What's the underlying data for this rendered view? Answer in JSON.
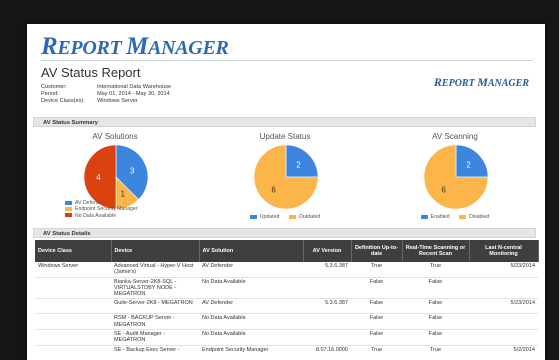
{
  "header": {
    "logo_first": "R",
    "logo_rest": "EPORT ",
    "logo_first2": "M",
    "logo_rest2": "ANAGER",
    "report_title": "AV Status Report"
  },
  "meta": {
    "customer_label": "Customer:",
    "customer": "International Data Warehouse",
    "period_label": "Period:",
    "period": "May 01, 2014 - May 30, 2014",
    "device_class_label": "Device Class(es):",
    "device_class": "Windows Server"
  },
  "sections": {
    "summary": "AV Status Summary",
    "details": "AV Status Details"
  },
  "charts": {
    "solutions_title": "AV Solutions",
    "update_title": "Update Status",
    "scanning_title": "AV Scanning",
    "legend_av_defender": "AV Defender",
    "legend_esm": "Endpoint Security Manager",
    "legend_no_data": "No Data Available",
    "legend_updated": "Updated",
    "legend_outdated": "Outdated",
    "legend_enabled": "Enabled",
    "legend_disabled": "Disabled"
  },
  "chart_data": [
    {
      "type": "pie",
      "title": "AV Solutions",
      "labels": [
        "AV Defender",
        "Endpoint Security Manager",
        "No Data Available"
      ],
      "values": [
        3,
        1,
        4
      ],
      "colors": [
        "#3d86e0",
        "#fbb548",
        "#dc4210"
      ]
    },
    {
      "type": "pie",
      "title": "Update Status",
      "labels": [
        "Updated",
        "Outdated"
      ],
      "values": [
        2,
        6
      ],
      "colors": [
        "#3d86e0",
        "#fbb548"
      ]
    },
    {
      "type": "pie",
      "title": "AV Scanning",
      "labels": [
        "Enabled",
        "Disabled"
      ],
      "values": [
        2,
        6
      ],
      "colors": [
        "#3d86e0",
        "#fbb548"
      ]
    }
  ],
  "table": {
    "headers": {
      "device_class": "Device Class",
      "device": "Device",
      "av_solution": "AV Solution",
      "av_version": "AV Version",
      "def_up_to_date": "Definition Up-to-date",
      "realtime": "Real-Time Scanning or Recent Scan",
      "last_nc": "Last N-central Monitoring"
    },
    "rows": [
      {
        "device_class": "Windows Server",
        "device": "Advanced Virtual - Hyper-V Host (Jamie's)",
        "av_solution": "AV Defender",
        "av_version": "5.3.6.387",
        "def": "True",
        "rt": "True",
        "last": "5/23/2014"
      },
      {
        "device_class": "",
        "device": "Bianka-Server-2K8-SQL - VIRTUALSTDBY NODE - MEGATRON",
        "av_solution": "No Data Available",
        "av_version": "",
        "def": "False",
        "rt": "False",
        "last": ""
      },
      {
        "device_class": "",
        "device": "Guile-Server-2K8 - MEGATRON",
        "av_solution": "AV Defender",
        "av_version": "5.3.6.387",
        "def": "False",
        "rt": "False",
        "last": "5/23/2014"
      },
      {
        "device_class": "",
        "device": "RSM - BACKUP Server - MEGATRON",
        "av_solution": "No Data Available",
        "av_version": "",
        "def": "False",
        "rt": "False",
        "last": ""
      },
      {
        "device_class": "",
        "device": "SE - Audit Manager - MEGATRON",
        "av_solution": "No Data Available",
        "av_version": "",
        "def": "False",
        "rt": "False",
        "last": ""
      },
      {
        "device_class": "",
        "device": "SE - Backup Exec Server -",
        "av_solution": "Endpoint Security Manager",
        "av_version": "8.07.16.0000",
        "def": "True",
        "rt": "True",
        "last": "5/2/2014"
      }
    ]
  }
}
